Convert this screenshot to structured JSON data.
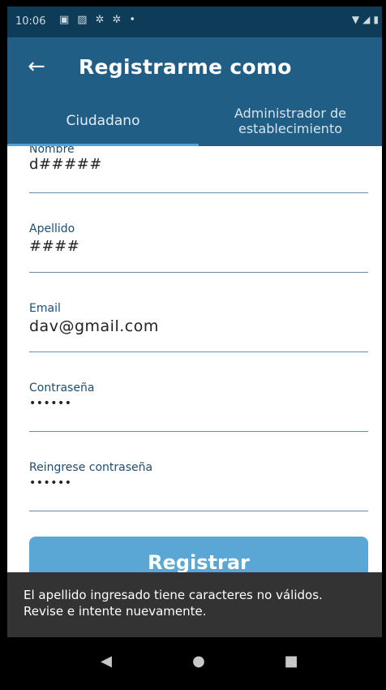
{
  "status_bar": {
    "time": "10:06",
    "left_icons": [
      "notification-icon",
      "image-icon",
      "settings-icon",
      "settings-icon",
      "dot-icon"
    ],
    "right_icons": [
      "wifi-icon",
      "signal-icon",
      "battery-icon"
    ]
  },
  "app_bar": {
    "title": "Registrarme como"
  },
  "tabs": [
    {
      "label": "Ciudadano",
      "selected": true
    },
    {
      "label": "Administrador de establecimiento",
      "selected": false
    }
  ],
  "form": {
    "fields": [
      {
        "label": "Nombre",
        "value": "d#####"
      },
      {
        "label": "Apellido",
        "value": "####"
      },
      {
        "label": "Email",
        "value": "dav@gmail.com"
      },
      {
        "label": "Contraseña",
        "value": "••••••"
      },
      {
        "label": "Reingrese contraseña",
        "value": "••••••"
      }
    ],
    "submit_label": "Registrar"
  },
  "snackbar": {
    "message": "El apellido ingresado tiene caracteres no válidos. Revise e intente nuevamente."
  },
  "colors": {
    "app_bar": "#215e85",
    "status_bar": "#0e3b58",
    "tab_indicator": "#4aa3de",
    "button": "#5aa7d6",
    "snackbar": "#333333"
  }
}
